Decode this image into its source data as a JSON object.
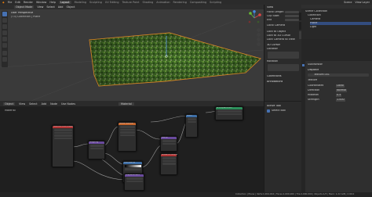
{
  "app": {
    "menus": [
      "File",
      "Edit",
      "Render",
      "Window",
      "Help"
    ],
    "workspaces": [
      "Layout",
      "Modeling",
      "Sculpting",
      "UV Editing",
      "Texture Paint",
      "Shading",
      "Animation",
      "Rendering",
      "Compositing",
      "Scripting"
    ],
    "active_workspace": "Layout",
    "scene": "Scene",
    "view_layer": "View Layer"
  },
  "viewport": {
    "mode": "Object Mode",
    "header_items": [
      "View",
      "Select",
      "Add",
      "Object"
    ],
    "overlay_title": "User Perspective",
    "overlay_sub": "(73) Collection | Plane"
  },
  "npanel": {
    "view_header": "View",
    "focal_length": "Focal Length",
    "clip_start": "Clip Start",
    "clip_end": "End",
    "local_camera": "Local Camera",
    "lock_to_object": "Lock to Object",
    "lock_3d_cursor": "Lock to 3D Cursor",
    "lock_camera": "Lock Camera to View",
    "cursor_header": "3D Cursor",
    "location": "Location",
    "rotation": "Rotation",
    "collections_header": "Collections",
    "annotations_header": "Annotations",
    "tabs": [
      "Item",
      "Tool",
      "View"
    ]
  },
  "outliner": {
    "rows": [
      "Scene Collection",
      "Collection",
      "Camera",
      "Plane",
      "Light"
    ]
  },
  "node_editor": {
    "header_items": [
      "Object",
      "View",
      "Select",
      "Add",
      "Node",
      "Use Nodes"
    ],
    "material": "Material",
    "active_tool_header": "Active Tool",
    "active_tool": "Select Box",
    "breadcrumb": "Material",
    "nodes": {
      "output": "Material Output",
      "principled": "Principled BSDF",
      "color_ramp": "ColorRamp",
      "noise": "Noise Texture",
      "bump": "Bump",
      "mapping": "Mapping",
      "tex_coord": "Texture Coordinate",
      "math": "Math",
      "displacement": "Displacement"
    }
  },
  "properties": {
    "modifier_name": "Subdivision",
    "texture_name": "Texture.001",
    "labels": [
      "Displace",
      "Texture",
      "Coordinates",
      "Direction",
      "Midlevel",
      "Strength"
    ],
    "values": [
      "Local",
      "Normal",
      "0.5",
      "1.000"
    ]
  },
  "statusbar": {
    "left": "Collection | Plane | Verts:1,004,004 | Faces:1,000,000 | Tris:2,000,000 | Objects:1/3 | Mem: 1.22 GiB | 2.90.0"
  },
  "colors": {
    "accent": "#4772b3",
    "active_orange": "#e8922a",
    "terrain_green": "#4f7c2e",
    "header_shader": "#2c8f5a",
    "header_texture": "#c4652d",
    "header_vector": "#6a4a9e",
    "header_input": "#b03434",
    "header_converter": "#3d6ea6"
  }
}
